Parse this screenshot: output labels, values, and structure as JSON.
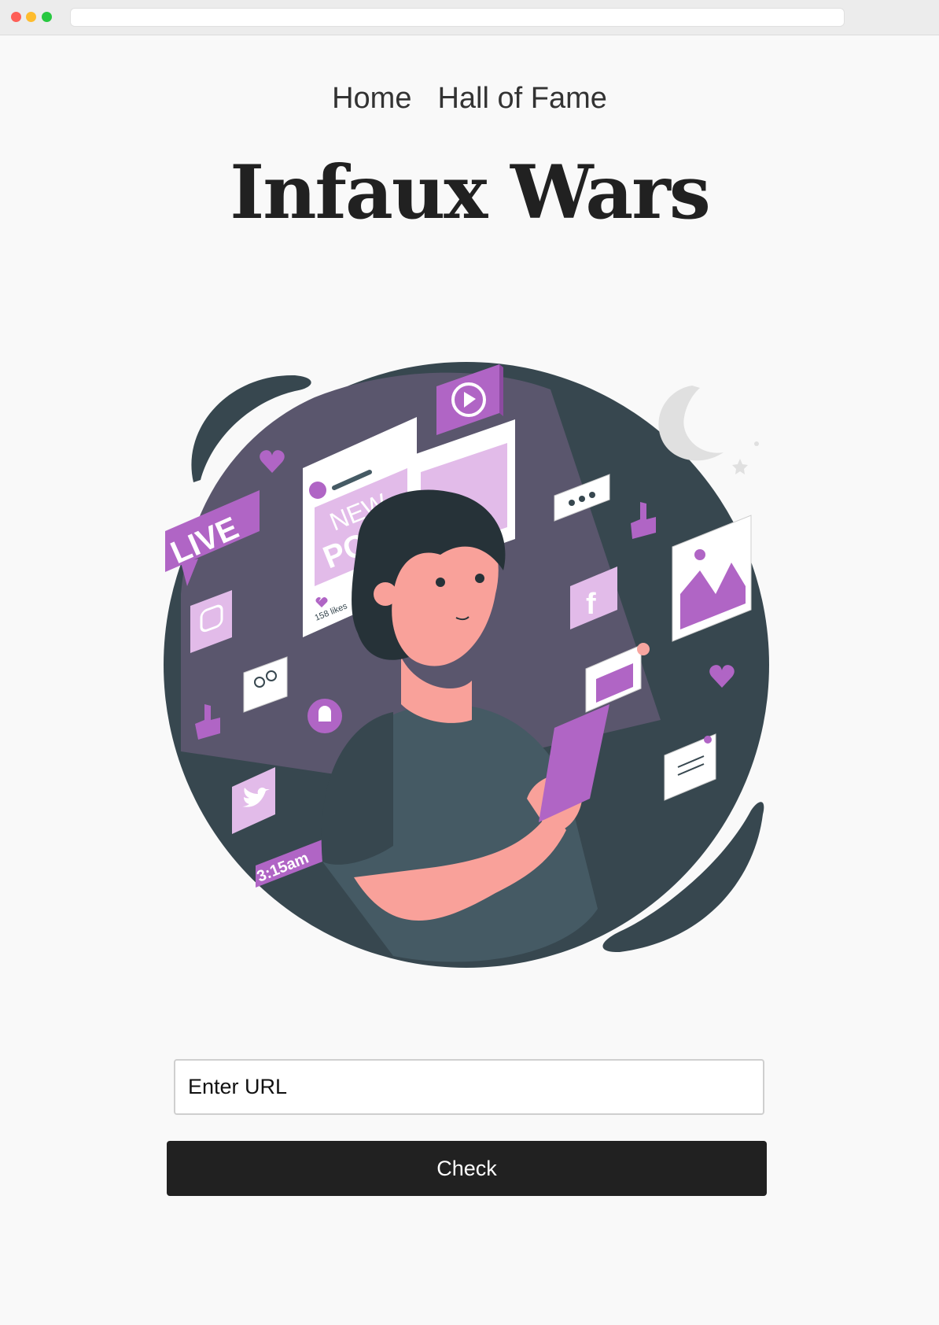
{
  "nav": {
    "home": "Home",
    "hall_of_fame": "Hall of Fame"
  },
  "hero": {
    "title": "Infaux Wars"
  },
  "illustration": {
    "live_label": "LIVE",
    "post_line1": "NEW",
    "post_line2": "POST",
    "likes": "158 likes",
    "time": "3:15am",
    "facebook_glyph": "f"
  },
  "form": {
    "url_placeholder": "Enter URL",
    "check_label": "Check"
  },
  "colors": {
    "accent": "#b065c5",
    "dark": "#212121",
    "background": "#f9f9f9"
  }
}
